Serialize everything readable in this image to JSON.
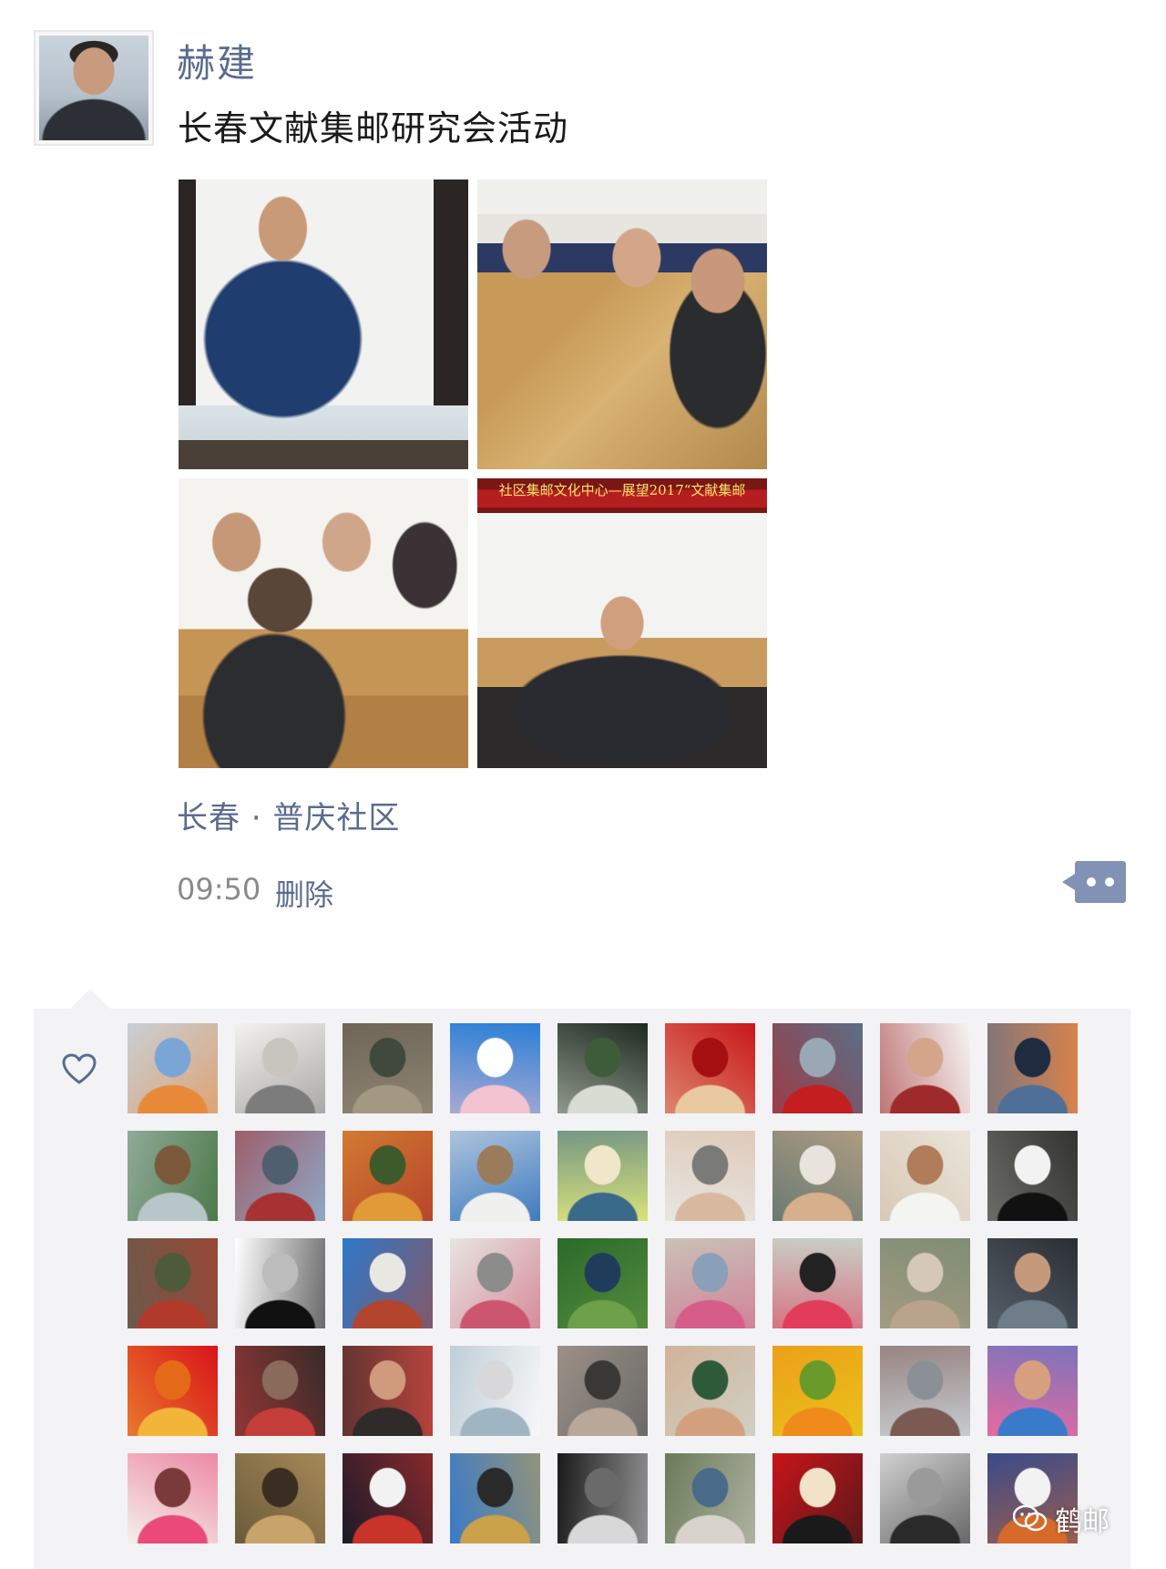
{
  "post": {
    "author": "赫建",
    "text": "长春文献集邮研究会活动",
    "location": "长春 · 普庆社区",
    "time": "09:50",
    "delete_label": "删除",
    "photo_banner": "社区集邮文化中心—展望2017“文献集邮"
  },
  "colors": {
    "link": "#5b6b8f",
    "likes_background": "#f3f3f5",
    "comment_button": "#8292b4"
  },
  "watermark": {
    "text": "鹤邮"
  },
  "likes": {
    "count_shown": 45,
    "avatar_palettes": [
      [
        "#c9cfd6",
        "#e8893a",
        "#7aa6d6"
      ],
      [
        "#f4f2ee",
        "#7c7c7c",
        "#c8c5bf"
      ],
      [
        "#6e6558",
        "#a39883",
        "#3f4a3c"
      ],
      [
        "#2b7fd6",
        "#f2c3d0",
        "#ffffff"
      ],
      [
        "#1d2a1f",
        "#d8dcd2",
        "#3f5c3a"
      ],
      [
        "#c9161a",
        "#e8c9a0",
        "#a50f12"
      ],
      [
        "#5a6e86",
        "#c41e20",
        "#9aa7b4"
      ],
      [
        "#f5f5f3",
        "#9e2a2b",
        "#d4a58b"
      ],
      [
        "#d9824a",
        "#4e6f97",
        "#1f2b3e"
      ],
      [
        "#4d7a4a",
        "#b7c6c9",
        "#7a5a3a"
      ],
      [
        "#8fa8c7",
        "#a63232",
        "#4f5f6e"
      ],
      [
        "#b8442a",
        "#e09b36",
        "#3d5a2a"
      ],
      [
        "#3e7bbf",
        "#f0f0ee",
        "#9a7b5c"
      ],
      [
        "#d9e27a",
        "#3a6a8a",
        "#f0e6c8"
      ],
      [
        "#e8e6e2",
        "#d8b9a0",
        "#7a7a78"
      ],
      [
        "#6a7a72",
        "#d6b08c",
        "#e9e4db"
      ],
      [
        "#d8c9b5",
        "#f4f4f1",
        "#b07c5a"
      ],
      [
        "#6b6b68",
        "#111111",
        "#f2f2f2"
      ],
      [
        "#6d5a4a",
        "#b23a2a",
        "#4f5a3a"
      ],
      [
        "#ffffff",
        "#111111",
        "#bcbcbc"
      ],
      [
        "#2f78c9",
        "#b3452e",
        "#e9e7e2"
      ],
      [
        "#e7e5e2",
        "#cc5570",
        "#8c8c8a"
      ],
      [
        "#2b6a2a",
        "#6ea04a",
        "#1f3d5a"
      ],
      [
        "#c9c2b6",
        "#d65d8a",
        "#8aa0b8"
      ],
      [
        "#c7d0c6",
        "#e23c5b",
        "#222222"
      ],
      [
        "#7f8d74",
        "#b9a38c",
        "#d6c8b8"
      ],
      [
        "#2a2e33",
        "#6f7d8a",
        "#c49a7a"
      ],
      [
        "#d8141a",
        "#f3b43a",
        "#e46a1a"
      ],
      [
        "#3a2a2a",
        "#c43e3a",
        "#8a6a5a"
      ],
      [
        "#b7433c",
        "#2e2b2a",
        "#d09b7c"
      ],
      [
        "#f7f7f8",
        "#9fb6c2",
        "#d8d8da"
      ],
      [
        "#6b6a68",
        "#b9a79a",
        "#3a3836"
      ],
      [
        "#cfd0c4",
        "#d3a07e",
        "#2f5a3a"
      ],
      [
        "#e8c21a",
        "#f08a1a",
        "#6a9a2a"
      ],
      [
        "#c7cbd0",
        "#7a5a52",
        "#8a9096"
      ],
      [
        "#e66aa0",
        "#3a7acb",
        "#d6a080"
      ],
      [
        "#f4f1ea",
        "#e94a7a",
        "#7a3a3a"
      ],
      [
        "#6a5a3a",
        "#c9a46a",
        "#3a2e22"
      ],
      [
        "#1a1a2a",
        "#c8332a",
        "#f2f2f2"
      ],
      [
        "#3a7ac9",
        "#c9a24a",
        "#2a2a2a"
      ],
      [
        "#1a1a1a",
        "#d8d8d8",
        "#6a6a6a"
      ],
      [
        "#6a7a5a",
        "#d8d4cc",
        "#4a6a8a"
      ],
      [
        "#c8141a",
        "#1a1a1a",
        "#f2e2c8"
      ],
      [
        "#d0d0d0",
        "#2a2a2a",
        "#9a9a9a"
      ],
      [
        "#3a4a8a",
        "#d66a2a",
        "#f2f2f2"
      ]
    ]
  }
}
